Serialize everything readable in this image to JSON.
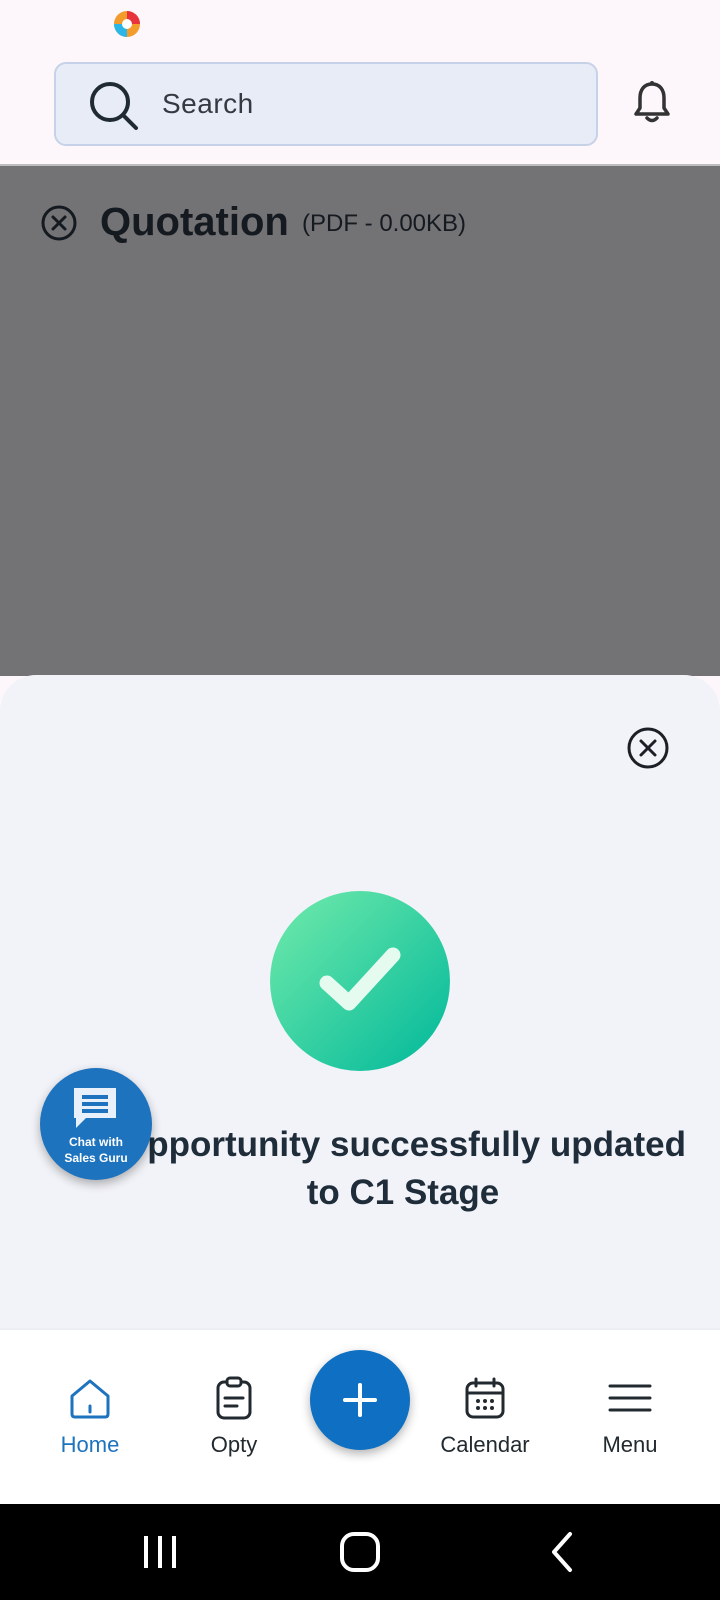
{
  "search": {
    "placeholder": "Search"
  },
  "document": {
    "title": "Quotation",
    "meta": "(PDF - 0.00KB)"
  },
  "dialog": {
    "message": "Opportunity successfully updated to C1 Stage"
  },
  "chat": {
    "line1": "Chat with",
    "line2": "Sales Guru"
  },
  "nav": {
    "items": [
      {
        "label": "Home",
        "icon": "home-icon",
        "active": true
      },
      {
        "label": "Opty",
        "icon": "clipboard-icon",
        "active": false
      },
      {
        "label": "Calendar",
        "icon": "calendar-icon",
        "active": false
      },
      {
        "label": "Menu",
        "icon": "hamburger-icon",
        "active": false
      }
    ]
  },
  "colors": {
    "accent": "#1e73bf",
    "success_start": "#72ebab",
    "success_end": "#00b89a",
    "dim_overlay": "#737275"
  }
}
